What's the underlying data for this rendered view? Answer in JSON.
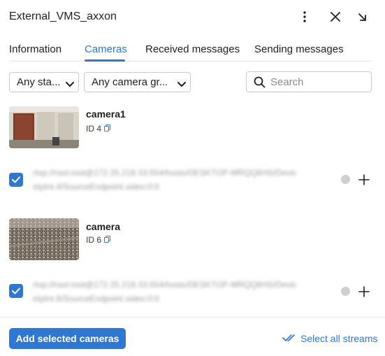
{
  "header": {
    "title": "External_VMS_axxon",
    "icons": [
      "kebab-menu-icon",
      "close-icon",
      "arrow-down-right-icon"
    ]
  },
  "tabs": [
    {
      "label": "Information",
      "active": false
    },
    {
      "label": "Cameras",
      "active": true
    },
    {
      "label": "Received messages",
      "active": false
    },
    {
      "label": "Sending messages",
      "active": false
    }
  ],
  "filters": {
    "status_label": "Any sta...",
    "group_label": "Any camera gr...",
    "search_placeholder": "Search"
  },
  "cameras": [
    {
      "name": "camera1",
      "id_label": "ID 4",
      "stream": {
        "checked": true,
        "url_line1": "rtsp://root:root@172.25.218.33:554/hosts/DESKTOP-MRQQ6HS/Devic",
        "url_line2": "eIpInt.4/SourceEndpoint.video:0:0",
        "status": "inactive"
      }
    },
    {
      "name": "camera",
      "id_label": "ID 6",
      "stream": {
        "checked": true,
        "url_line1": "rtsp://root:root@172.25.218.33:554/hosts/DESKTOP-MRQQ6HS/Devic",
        "url_line2": "eIpInt.6/SourceEndpoint.video:0:0",
        "status": "inactive"
      }
    }
  ],
  "footer": {
    "add_label": "Add selected cameras",
    "select_all_label": "Select all streams"
  },
  "colors": {
    "accent": "#2f77d0",
    "status_inactive": "#cfcfcf"
  }
}
